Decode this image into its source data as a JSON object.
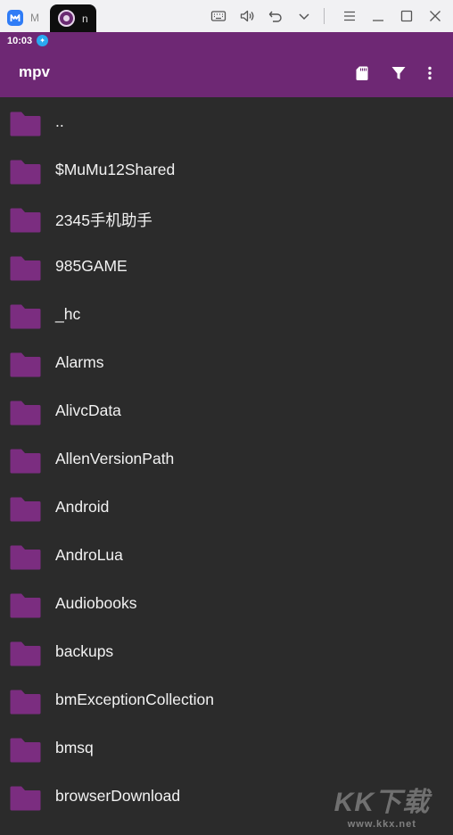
{
  "emulator": {
    "tabs": [
      {
        "label": "M"
      },
      {
        "label": "n"
      }
    ],
    "toolbar_icons": [
      "keyboard-icon",
      "volume-icon",
      "back-icon",
      "chevron-down-icon",
      "menu-icon",
      "minimize-icon",
      "maximize-icon",
      "close-icon"
    ]
  },
  "status_bar": {
    "time": "10:03"
  },
  "app_bar": {
    "title": "mpv",
    "actions": [
      "sd-card-icon",
      "filter-icon",
      "more-vert-icon"
    ]
  },
  "colors": {
    "primary": "#6e2874",
    "background": "#2b2b2b",
    "folder": "#7b2d80",
    "text": "#f2f2f2"
  },
  "folders": [
    {
      "name": ".."
    },
    {
      "name": "$MuMu12Shared"
    },
    {
      "name": "2345手机助手"
    },
    {
      "name": "985GAME"
    },
    {
      "name": "_hc"
    },
    {
      "name": "Alarms"
    },
    {
      "name": "AlivcData"
    },
    {
      "name": "AllenVersionPath"
    },
    {
      "name": "Android"
    },
    {
      "name": "AndroLua"
    },
    {
      "name": "Audiobooks"
    },
    {
      "name": "backups"
    },
    {
      "name": "bmExceptionCollection"
    },
    {
      "name": "bmsq"
    },
    {
      "name": "browserDownload"
    }
  ],
  "watermark": {
    "big": "KK下载",
    "small": "www.kkx.net"
  }
}
